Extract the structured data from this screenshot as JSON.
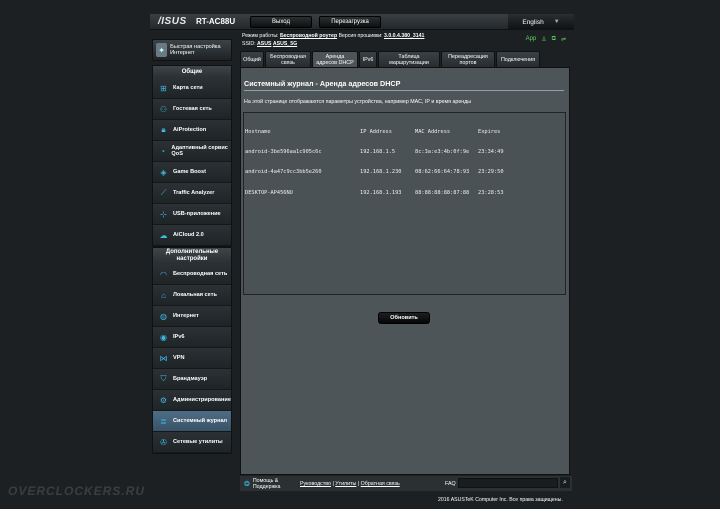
{
  "header": {
    "logo": "/ISUS",
    "model": "RT-AC88U",
    "logout_label": "Выход",
    "reboot_label": "Перезагрузка",
    "language": "English"
  },
  "status": {
    "mode_label": "Режим работы:",
    "mode_value": "Беспроводной роутер",
    "firmware_label": "Версия прошивки:",
    "firmware_value": "3.0.0.4.380_3141",
    "ssid_label": "SSID:",
    "ssid_1": "ASUS",
    "ssid_2": "ASUS_5G",
    "app_label": "App"
  },
  "quick_setup": {
    "label": "Быстрая настройка Интернет"
  },
  "sidebar": {
    "general_title": "Общие",
    "general": [
      {
        "label": "Карта сети",
        "icon": "network-map-icon"
      },
      {
        "label": "Гостевая сеть",
        "icon": "guest-network-icon"
      },
      {
        "label": "AiProtection",
        "icon": "lock-icon"
      },
      {
        "label": "Адаптивный сервис QoS",
        "icon": "qos-icon"
      },
      {
        "label": "Game Boost",
        "icon": "gamepad-icon"
      },
      {
        "label": "Traffic Analyzer",
        "icon": "chart-icon"
      },
      {
        "label": "USB-приложение",
        "icon": "usb-icon"
      },
      {
        "label": "AiCloud 2.0",
        "icon": "cloud-icon"
      }
    ],
    "advanced_title": "Дополнительные настройки",
    "advanced": [
      {
        "label": "Беспроводная сеть",
        "icon": "wifi-icon"
      },
      {
        "label": "Локальная сеть",
        "icon": "home-icon"
      },
      {
        "label": "Интернет",
        "icon": "globe-icon"
      },
      {
        "label": "IPv6",
        "icon": "ipv6-icon"
      },
      {
        "label": "VPN",
        "icon": "vpn-icon"
      },
      {
        "label": "Брандмауэр",
        "icon": "firewall-icon"
      },
      {
        "label": "Администрирование",
        "icon": "admin-icon"
      },
      {
        "label": "Системный журнал",
        "icon": "log-icon"
      },
      {
        "label": "Сетевые утилиты",
        "icon": "tools-icon"
      }
    ]
  },
  "tabs": [
    {
      "label": "Общий"
    },
    {
      "label": "Беспроводная связь"
    },
    {
      "label": "Аренда адресов DHCP"
    },
    {
      "label": "IPv6"
    },
    {
      "label": "Таблица маршрутизации"
    },
    {
      "label": "Переадресация портов"
    },
    {
      "label": "Подключения"
    }
  ],
  "main": {
    "title": "Системный журнал - Аренда адресов DHCP",
    "description": "На этой странице отображаются параметры устройства, например MAC, IP и время аренды",
    "columns": [
      "Hostname",
      "IP Address",
      "MAC Address",
      "Expires"
    ],
    "rows": [
      [
        "android-3be596aa1c905c6c",
        "192.168.1.5",
        "8c:3a:e3:4b:0f:9e",
        "23:34:49"
      ],
      [
        "android-4a47c9cc3bb5e260",
        "192.168.1.230",
        "08:62:66:64:78:93",
        "23:29:50"
      ],
      [
        "DESKTOP-AP456NU",
        "192.168.1.193",
        "88:88:88:88:87:88",
        "23:28:53"
      ]
    ],
    "refresh_label": "Обновить"
  },
  "footer": {
    "help_label": "Помощь & Поддержка",
    "manual": "Руководство",
    "utilities": "Утилиты",
    "feedback": "Обратная связь",
    "separator": " | ",
    "faq": "FAQ",
    "copyright": "2016 ASUSTeK Computer Inc. Все права защищены."
  },
  "watermark": "OVERCLOCKERS.RU"
}
